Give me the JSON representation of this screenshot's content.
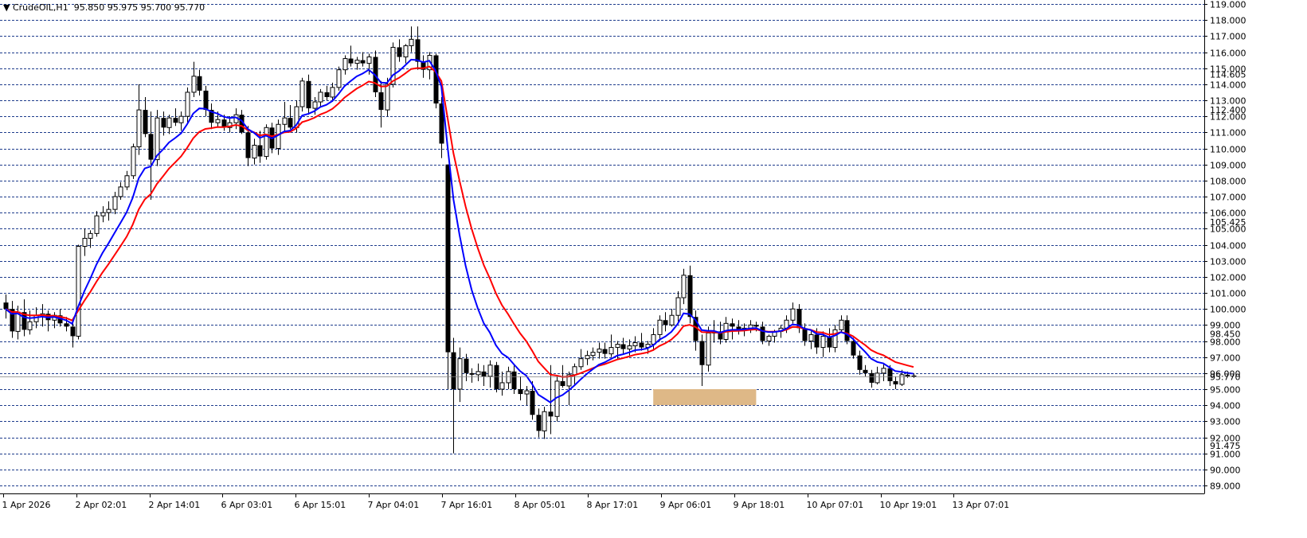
{
  "header": {
    "symbol": "CrudeOIL,H1",
    "ohlc": "95.850 95.975 95.700 95.770"
  },
  "chart_data": {
    "type": "candlestick",
    "timeframe": "H1",
    "y_axis": {
      "min": 89,
      "max": 119,
      "step": 1,
      "side": "right"
    },
    "y_ticks": [
      "119.000",
      "118.000",
      "117.000",
      "116.000",
      "115.000",
      "114.000",
      "113.000",
      "112.000",
      "111.000",
      "110.000",
      "109.000",
      "108.000",
      "107.000",
      "106.000",
      "105.000",
      "104.000",
      "103.000",
      "102.000",
      "101.000",
      "100.000",
      "99.000",
      "98.000",
      "97.000",
      "96.000",
      "95.000",
      "94.000",
      "93.000",
      "92.000",
      "91.000",
      "90.000",
      "89.000"
    ],
    "x_tick_labels": [
      "1 Apr 2026",
      "2 Apr 02:01",
      "2 Apr 14:01",
      "6 Apr 03:01",
      "6 Apr 15:01",
      "7 Apr 04:01",
      "7 Apr 16:01",
      "8 Apr 05:01",
      "8 Apr 17:01",
      "9 Apr 06:01",
      "9 Apr 18:01",
      "10 Apr 07:01",
      "10 Apr 19:01",
      "13 Apr 07:01"
    ],
    "price_labels": [
      {
        "text": "114.605",
        "value": 114.6
      },
      {
        "text": "112.400",
        "value": 112.4
      },
      {
        "text": "105.425",
        "value": 105.425
      },
      {
        "text": "98.450",
        "value": 98.45
      },
      {
        "text": "95.770",
        "value": 95.77
      },
      {
        "text": "91.475",
        "value": 91.475
      }
    ],
    "current_price": 95.77,
    "support_zone": {
      "from_bar": 107,
      "to_bar": 124,
      "low": 94.0,
      "high": 95.0,
      "color": "#deb887"
    },
    "colors": {
      "ma_fast": "#0000ff",
      "ma_slow": "#ff0000",
      "grid": "#1e3c8c",
      "candle": "#000000"
    },
    "candles": [
      [
        100.4,
        100.9,
        99.4,
        100.0
      ],
      [
        100.0,
        100.5,
        98.2,
        98.6
      ],
      [
        98.6,
        100.2,
        98.1,
        99.8
      ],
      [
        99.8,
        100.6,
        98.3,
        98.7
      ],
      [
        98.7,
        99.9,
        98.4,
        99.2
      ],
      [
        99.2,
        100.1,
        98.8,
        99.6
      ],
      [
        99.6,
        100.3,
        98.9,
        99.7
      ],
      [
        99.7,
        99.9,
        98.6,
        99.3
      ],
      [
        99.3,
        99.8,
        98.8,
        99.6
      ],
      [
        99.6,
        100.0,
        98.9,
        99.1
      ],
      [
        99.1,
        99.5,
        98.6,
        98.9
      ],
      [
        98.9,
        99.3,
        97.6,
        98.3
      ],
      [
        98.3,
        104.0,
        98.1,
        103.9
      ],
      [
        103.9,
        105.0,
        103.3,
        104.4
      ],
      [
        104.4,
        104.9,
        103.8,
        104.7
      ],
      [
        104.7,
        106.1,
        104.5,
        105.8
      ],
      [
        105.8,
        106.4,
        105.4,
        106.0
      ],
      [
        106.0,
        106.7,
        105.5,
        106.2
      ],
      [
        106.2,
        107.3,
        105.9,
        107.0
      ],
      [
        107.0,
        107.9,
        106.8,
        107.6
      ],
      [
        107.6,
        108.6,
        107.4,
        108.3
      ],
      [
        108.3,
        110.3,
        108.1,
        110.1
      ],
      [
        110.1,
        114.0,
        109.6,
        112.4
      ],
      [
        112.4,
        113.2,
        110.7,
        110.9
      ],
      [
        110.9,
        112.3,
        106.8,
        109.3
      ],
      [
        109.3,
        112.4,
        108.9,
        111.9
      ],
      [
        111.9,
        112.3,
        110.8,
        111.3
      ],
      [
        111.3,
        112.1,
        110.9,
        111.9
      ],
      [
        111.9,
        112.5,
        111.4,
        111.6
      ],
      [
        111.6,
        112.3,
        111.1,
        112.0
      ],
      [
        112.0,
        113.8,
        111.6,
        113.5
      ],
      [
        113.5,
        115.4,
        113.2,
        114.5
      ],
      [
        114.5,
        114.9,
        113.3,
        113.6
      ],
      [
        113.6,
        113.9,
        112.0,
        112.4
      ],
      [
        112.4,
        112.8,
        111.2,
        111.6
      ],
      [
        111.6,
        112.3,
        111.3,
        111.8
      ],
      [
        111.8,
        112.1,
        111.1,
        111.3
      ],
      [
        111.3,
        112.0,
        111.0,
        111.6
      ],
      [
        111.6,
        112.5,
        111.2,
        112.1
      ],
      [
        112.1,
        112.4,
        110.9,
        111.0
      ],
      [
        111.0,
        111.4,
        108.9,
        109.4
      ],
      [
        109.4,
        110.6,
        109.0,
        110.2
      ],
      [
        110.2,
        111.1,
        109.1,
        109.5
      ],
      [
        109.5,
        111.5,
        109.3,
        111.3
      ],
      [
        111.3,
        111.6,
        109.7,
        110.0
      ],
      [
        110.0,
        111.8,
        109.6,
        111.5
      ],
      [
        111.5,
        112.9,
        111.1,
        111.9
      ],
      [
        111.9,
        112.7,
        111.2,
        111.3
      ],
      [
        111.3,
        113.0,
        111.0,
        112.6
      ],
      [
        112.6,
        114.4,
        112.3,
        114.2
      ],
      [
        114.2,
        114.6,
        112.1,
        112.5
      ],
      [
        112.5,
        113.2,
        112.1,
        112.9
      ],
      [
        112.9,
        113.7,
        112.6,
        113.5
      ],
      [
        113.5,
        113.9,
        113.0,
        113.2
      ],
      [
        113.2,
        114.1,
        112.9,
        113.8
      ],
      [
        113.8,
        115.1,
        113.6,
        114.9
      ],
      [
        114.9,
        115.8,
        114.6,
        115.6
      ],
      [
        115.6,
        116.4,
        115.1,
        115.3
      ],
      [
        115.3,
        115.7,
        114.9,
        115.5
      ],
      [
        115.5,
        116.0,
        115.1,
        115.3
      ],
      [
        115.3,
        115.9,
        114.6,
        115.7
      ],
      [
        115.7,
        116.1,
        113.2,
        113.5
      ],
      [
        113.5,
        114.2,
        111.3,
        112.4
      ],
      [
        112.4,
        114.4,
        112.0,
        114.0
      ],
      [
        114.0,
        116.6,
        113.8,
        116.3
      ],
      [
        116.3,
        116.8,
        115.4,
        115.7
      ],
      [
        115.7,
        116.5,
        115.3,
        116.4
      ],
      [
        116.4,
        117.6,
        116.0,
        116.8
      ],
      [
        116.8,
        117.6,
        114.9,
        115.4
      ],
      [
        115.4,
        115.8,
        114.4,
        114.9
      ],
      [
        114.9,
        116.0,
        114.3,
        115.8
      ],
      [
        115.8,
        115.9,
        112.5,
        112.8
      ],
      [
        112.8,
        113.2,
        109.4,
        110.3
      ],
      [
        109.0,
        109.0,
        95.0,
        97.3
      ],
      [
        97.3,
        98.2,
        91.0,
        95.0
      ],
      [
        95.0,
        97.6,
        94.2,
        96.9
      ],
      [
        96.9,
        97.2,
        95.5,
        96.0
      ],
      [
        96.0,
        96.3,
        95.4,
        95.9
      ],
      [
        95.9,
        96.6,
        95.5,
        96.1
      ],
      [
        96.1,
        96.5,
        95.2,
        95.8
      ],
      [
        95.8,
        96.8,
        95.1,
        96.5
      ],
      [
        96.5,
        96.7,
        94.8,
        95.0
      ],
      [
        95.0,
        96.1,
        94.6,
        95.4
      ],
      [
        95.4,
        96.4,
        95.0,
        96.1
      ],
      [
        96.1,
        96.5,
        94.7,
        95.0
      ],
      [
        95.0,
        95.8,
        94.3,
        94.7
      ],
      [
        94.7,
        95.2,
        94.0,
        94.9
      ],
      [
        94.9,
        95.5,
        93.1,
        93.4
      ],
      [
        93.4,
        93.8,
        92.0,
        92.4
      ],
      [
        92.4,
        93.9,
        91.9,
        93.6
      ],
      [
        93.6,
        96.5,
        92.2,
        93.3
      ],
      [
        93.3,
        95.8,
        93.0,
        95.5
      ],
      [
        95.5,
        96.5,
        95.1,
        95.2
      ],
      [
        95.2,
        96.1,
        94.0,
        95.9
      ],
      [
        95.9,
        96.6,
        95.3,
        96.4
      ],
      [
        96.4,
        97.5,
        96.2,
        96.9
      ],
      [
        96.9,
        97.4,
        96.5,
        97.1
      ],
      [
        97.1,
        97.6,
        96.8,
        97.3
      ],
      [
        97.3,
        97.9,
        96.9,
        97.5
      ],
      [
        97.5,
        97.9,
        96.9,
        97.2
      ],
      [
        97.2,
        98.4,
        97.0,
        97.6
      ],
      [
        97.6,
        98.0,
        96.9,
        97.8
      ],
      [
        97.8,
        98.2,
        97.2,
        97.5
      ],
      [
        97.5,
        98.1,
        97.1,
        97.7
      ],
      [
        97.7,
        98.3,
        97.3,
        97.9
      ],
      [
        97.9,
        98.5,
        97.4,
        97.6
      ],
      [
        97.6,
        98.0,
        97.2,
        97.8
      ],
      [
        97.8,
        98.8,
        97.4,
        98.4
      ],
      [
        98.4,
        99.6,
        98.0,
        99.3
      ],
      [
        99.3,
        99.8,
        98.6,
        99.0
      ],
      [
        99.0,
        100.0,
        98.9,
        99.6
      ],
      [
        99.6,
        101.1,
        99.2,
        100.7
      ],
      [
        100.7,
        102.5,
        100.3,
        102.1
      ],
      [
        102.1,
        102.7,
        99.1,
        99.5
      ],
      [
        99.5,
        99.9,
        97.4,
        98.0
      ],
      [
        98.0,
        98.4,
        95.2,
        96.5
      ],
      [
        96.5,
        98.9,
        96.1,
        98.5
      ],
      [
        98.5,
        99.3,
        97.9,
        98.6
      ],
      [
        98.6,
        99.2,
        97.8,
        98.1
      ],
      [
        98.1,
        99.5,
        97.9,
        99.1
      ],
      [
        99.1,
        99.4,
        98.1,
        98.9
      ],
      [
        98.9,
        99.3,
        98.4,
        98.7
      ],
      [
        98.7,
        99.1,
        98.3,
        98.8
      ],
      [
        98.8,
        99.3,
        98.5,
        99.0
      ],
      [
        99.0,
        99.2,
        98.6,
        98.9
      ],
      [
        98.9,
        99.2,
        97.8,
        98.0
      ],
      [
        98.0,
        98.4,
        97.7,
        98.3
      ],
      [
        98.3,
        98.7,
        97.9,
        98.6
      ],
      [
        98.6,
        99.0,
        98.2,
        98.8
      ],
      [
        98.8,
        99.6,
        98.5,
        99.3
      ],
      [
        99.3,
        100.4,
        99.1,
        100.0
      ],
      [
        100.0,
        100.3,
        98.5,
        98.8
      ],
      [
        98.8,
        99.1,
        97.7,
        98.0
      ],
      [
        98.0,
        98.6,
        97.5,
        98.4
      ],
      [
        98.4,
        98.8,
        97.2,
        97.6
      ],
      [
        97.6,
        98.6,
        97.0,
        98.3
      ],
      [
        98.3,
        98.8,
        97.3,
        97.6
      ],
      [
        97.6,
        99.0,
        97.3,
        98.7
      ],
      [
        98.7,
        99.6,
        98.5,
        99.3
      ],
      [
        99.3,
        99.6,
        97.8,
        98.0
      ],
      [
        98.0,
        98.2,
        96.9,
        97.1
      ],
      [
        97.1,
        97.4,
        95.9,
        96.2
      ],
      [
        96.2,
        96.5,
        95.8,
        96.0
      ],
      [
        96.0,
        96.2,
        95.1,
        95.4
      ],
      [
        95.4,
        96.4,
        95.3,
        96.0
      ],
      [
        96.0,
        96.6,
        95.5,
        96.3
      ],
      [
        96.3,
        96.5,
        95.2,
        95.5
      ],
      [
        95.5,
        95.8,
        95.0,
        95.3
      ],
      [
        95.3,
        96.2,
        95.2,
        95.9
      ],
      [
        95.9,
        96.1,
        95.7,
        95.8
      ],
      [
        95.85,
        95.975,
        95.7,
        95.77
      ]
    ]
  }
}
